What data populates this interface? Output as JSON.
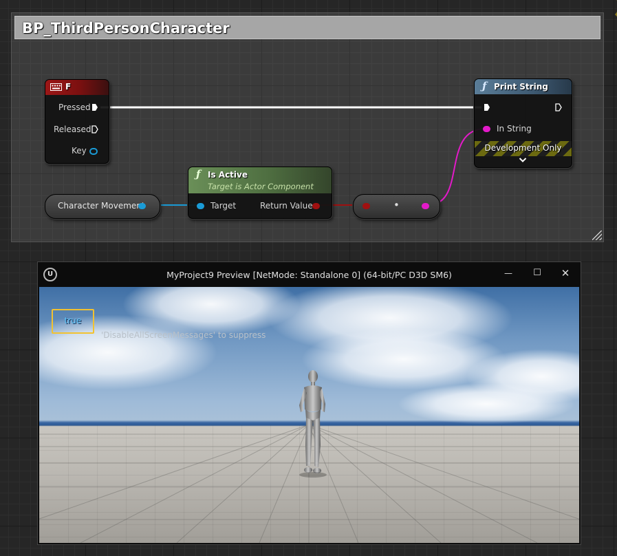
{
  "comment": {
    "title": "BP_ThirdPersonCharacter"
  },
  "key_event_node": {
    "title": "F",
    "icon": "keyboard-icon",
    "header_color": "#8c1414",
    "pins": {
      "pressed": "Pressed",
      "released": "Released",
      "key": "Key"
    }
  },
  "print_string_node": {
    "title": "Print String",
    "header_color": "#4f6a80",
    "in_string_label": "In String",
    "footer": "Development Only"
  },
  "is_active_node": {
    "title": "Is Active",
    "subtitle": "Target is Actor Component",
    "header_color": "#58774a",
    "target_label": "Target",
    "return_label": "Return Value"
  },
  "character_movement_node": {
    "label": "Character Movement"
  },
  "conversion_node": {
    "dot": "•"
  },
  "preview_window": {
    "title": "MyProject9 Preview [NetMode: Standalone 0]  (64-bit/PC D3D SM6)",
    "logo": "unreal-logo",
    "minimize": "—",
    "maximize": "☐",
    "close": "✕"
  },
  "viewport": {
    "message": "true",
    "suppress_text": "'DisableAllScreenMessages' to suppress"
  },
  "colors": {
    "exec_wire": "#ffffff",
    "object_pin": "#1a9bd6",
    "bool_pin": "#a01010",
    "string_pin": "#e31ac9",
    "highlight": "#f2c230"
  }
}
